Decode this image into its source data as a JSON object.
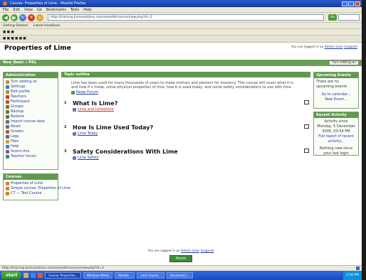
{
  "browser": {
    "title": "Course: Properties of Lime - Mozilla Firefox",
    "menu": [
      "File",
      "Edit",
      "View",
      "Go",
      "Bookmarks",
      "Tools",
      "Help"
    ],
    "url": "http://training.bsmsolutions.com/moodle/course/view.php?id=2",
    "bookmarks": [
      "Getting Started",
      "Latest Headlines"
    ],
    "status": "http://training.bsmsolutions.com/moodle/course/view.php?id=2"
  },
  "page": {
    "title": "Properties of Lime",
    "login_prefix": "You are logged in as",
    "login_user": "Admin User",
    "login_logout": "(Logout)",
    "breadcrumb": "New_Basic » P&L",
    "edit_button": "Turn editing on"
  },
  "admin_block": {
    "header": "Administration",
    "items": [
      {
        "label": "Turn editing on",
        "icon": "pencil-icon",
        "color": "#d08a2a"
      },
      {
        "label": "Settings",
        "icon": "settings-icon",
        "color": "#3f78c9"
      },
      {
        "label": "Edit profile",
        "icon": "profile-icon",
        "color": "#c9842a"
      },
      {
        "label": "Teachers",
        "icon": "teachers-icon",
        "color": "#a84d2e"
      },
      {
        "label": "Participant",
        "icon": "participant-icon",
        "color": "#b55a2f"
      },
      {
        "label": "Groups",
        "icon": "groups-icon",
        "color": "#8a6b2e"
      },
      {
        "label": "Backup",
        "icon": "backup-icon",
        "color": "#5a7b3b"
      },
      {
        "label": "Restore",
        "icon": "restore-icon",
        "color": "#5a7b3b"
      },
      {
        "label": "Import course data",
        "icon": "import-icon",
        "color": "#6a6a9a"
      },
      {
        "label": "Reset",
        "icon": "reset-icon",
        "color": "#7a6b5b"
      },
      {
        "label": "Grades",
        "icon": "grades-icon",
        "color": "#b45b2b"
      },
      {
        "label": "Logs",
        "icon": "logs-icon",
        "color": "#5b6b7b"
      },
      {
        "label": "Files",
        "icon": "files-icon",
        "color": "#c9a23a"
      },
      {
        "label": "Help",
        "icon": "help-icon",
        "color": "#4a7acb"
      },
      {
        "label": "Scorm.lms",
        "icon": "scorm-icon",
        "color": "#8a5a9a"
      },
      {
        "label": "Teacher forum",
        "icon": "forum-icon",
        "color": "#3b8a5b"
      }
    ]
  },
  "courses_block": {
    "header": "Courses",
    "items": [
      {
        "label": "Properties of Lime",
        "icon": "course-icon"
      },
      {
        "label": "Simple course: Properties of Lime",
        "icon": "course-icon"
      },
      {
        "label": "CT — Test Course",
        "icon": "course-icon"
      }
    ]
  },
  "outline": {
    "header": "Topic outline",
    "summary": "Lime has been used for many thousands of years to make mortars and plasters for masonry. This course will cover what it is and how it's made, some physical properties of lime, how it is used today, and some safety considerations to use with lime.",
    "summary_link": "News Forum",
    "topics": [
      {
        "num": "1",
        "title": "What Is Lime?",
        "link": "Lime and Limestone",
        "link_red": true
      },
      {
        "num": "2",
        "title": "How Is Lime Used Today?",
        "link": "Lime Today",
        "link_red": false
      },
      {
        "num": "3",
        "title": "Safety Considerations With Lime",
        "link": "Lime Safety",
        "link_red": false
      }
    ]
  },
  "events_block": {
    "header": "Upcoming Events",
    "text": "There are no upcoming events",
    "link1": "Go to calendar...",
    "link2": "New Event..."
  },
  "activity_block": {
    "header": "Recent Activity",
    "text1": "Activity since Monday, 5 December 2005, 03:54 PM",
    "link": "Full report of recent activity...",
    "text2": "Nothing new since your last login"
  },
  "footer": {
    "login_prefix": "You are logged in as",
    "login_user": "Admin User",
    "login_logout": "(Logout)",
    "home_button": "Home"
  },
  "taskbar": {
    "start": "start",
    "tasks": [
      "Course: Properties...",
      "Windows Media",
      "Moodle...",
      "Lime Course...",
      "Document1..."
    ],
    "clock": "3:58 PM"
  }
}
